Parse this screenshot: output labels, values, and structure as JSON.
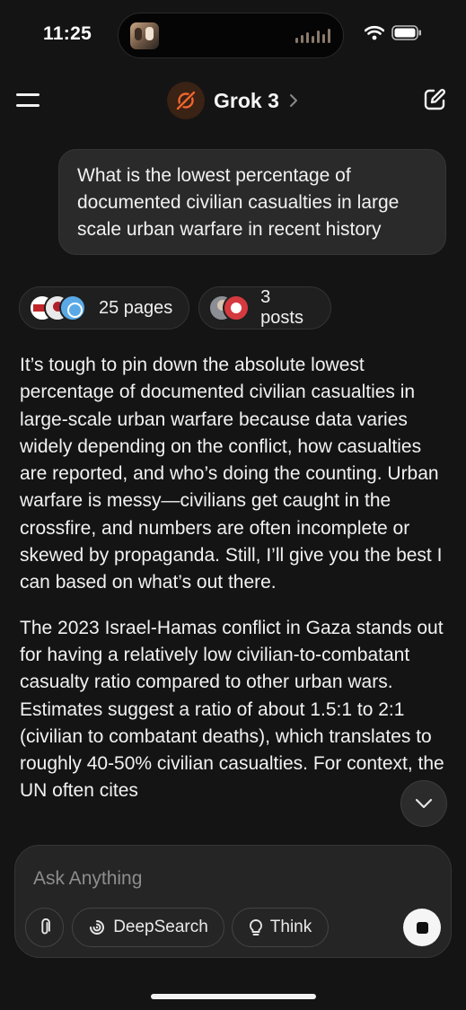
{
  "status_bar": {
    "time": "11:25",
    "icons": [
      "wifi-icon",
      "battery-icon"
    ]
  },
  "header": {
    "title": "Grok 3",
    "logo_icon": "grok-logo-icon",
    "menu_icon": "menu-icon",
    "new_chat_icon": "edit-icon",
    "accent_color": "#f0652d"
  },
  "conversation": {
    "user_message": "What is the lowest percentage of documented civilian casualties in large scale urban warfare in recent history",
    "sources": {
      "pages_label": "25 pages",
      "posts_label": "3 posts"
    },
    "answer_paragraphs": [
      "It’s tough to pin down the absolute lowest percentage of documented civilian casualties in large-scale urban warfare because data varies widely depending on the conflict, how casualties are reported, and who’s doing the counting. Urban warfare is messy—civilians get caught in the crossfire, and numbers are often incomplete or skewed by propaganda. Still, I’ll give you the best I can based on what’s out there.",
      "The 2023 Israel-Hamas conflict in Gaza stands out for having a relatively low civilian-to-combatant casualty ratio compared to other urban wars. Estimates suggest a ratio of about 1.5:1 to 2:1 (civilian to combatant deaths), which translates to roughly 40-50% civilian casualties. For context, the UN often cites"
    ]
  },
  "composer": {
    "placeholder": "Ask Anything",
    "value": "",
    "deepsearch_label": "DeepSearch",
    "think_label": "Think"
  },
  "colors": {
    "background": "#141414",
    "bubble": "#2a2a2a",
    "text": "#f2f2f2"
  }
}
